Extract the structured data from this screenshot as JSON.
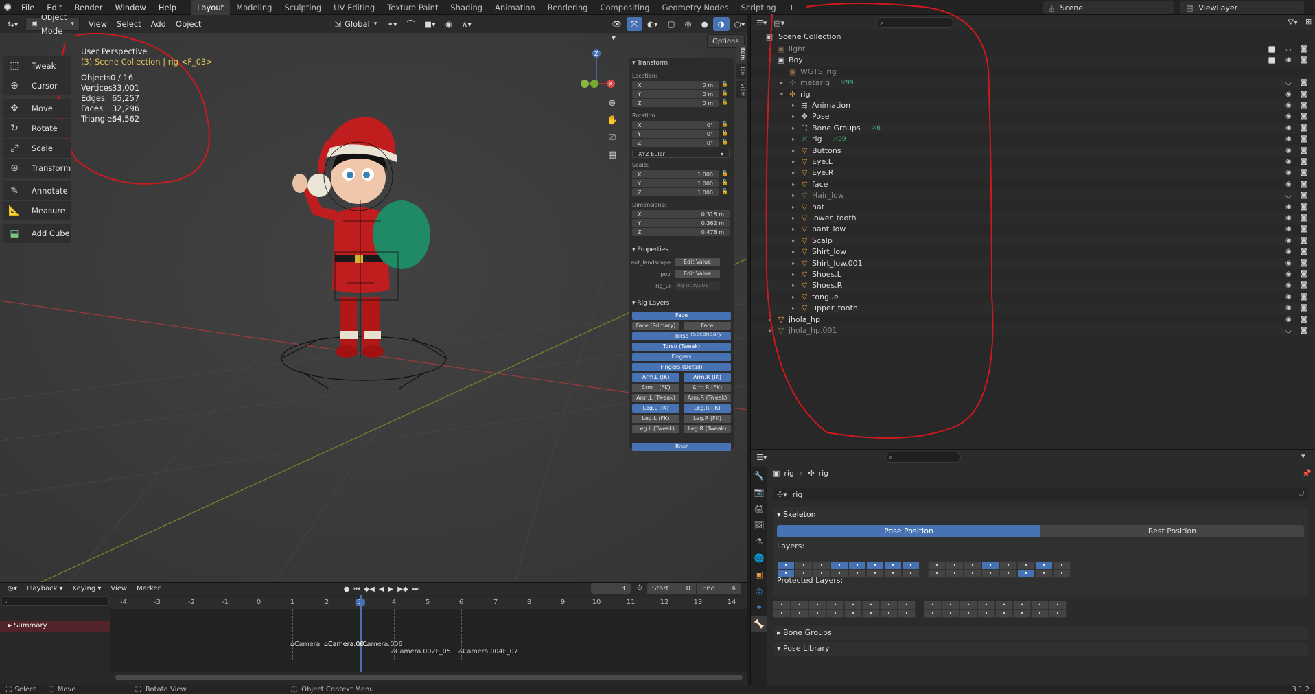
{
  "topbar": {
    "menus": [
      "File",
      "Edit",
      "Render",
      "Window",
      "Help"
    ],
    "workspaces": [
      "Layout",
      "Modeling",
      "Sculpting",
      "UV Editing",
      "Texture Paint",
      "Shading",
      "Animation",
      "Rendering",
      "Compositing",
      "Geometry Nodes",
      "Scripting"
    ],
    "active_workspace": "Layout",
    "scene": "Scene",
    "view_layer": "ViewLayer"
  },
  "viewport": {
    "mode": "Object Mode",
    "menus": [
      "View",
      "Select",
      "Add",
      "Object"
    ],
    "orientation": "Global",
    "options_label": "Options",
    "perspective": "User Perspective",
    "collection_info": "(3) Scene Collection | rig <F_03>",
    "stats": [
      {
        "label": "Objects",
        "value": "0 / 16"
      },
      {
        "label": "Vertices",
        "value": "33,001"
      },
      {
        "label": "Edges",
        "value": "65,257"
      },
      {
        "label": "Faces",
        "value": "32,296"
      },
      {
        "label": "Triangles",
        "value": "64,562"
      }
    ],
    "tools": [
      "Tweak",
      "Cursor",
      "Move",
      "Rotate",
      "Scale",
      "Transform",
      "Annotate",
      "Measure",
      "Add Cube"
    ],
    "side_tabs": [
      "Item",
      "Tool",
      "View"
    ]
  },
  "npanel": {
    "transform_title": "Transform",
    "location_label": "Location:",
    "location": {
      "x": "0 m",
      "y": "0 m",
      "z": "0 m"
    },
    "rotation_label": "Rotation:",
    "rotation": {
      "x": "0°",
      "y": "0°",
      "z": "0°"
    },
    "rotation_mode": "XYZ Euler",
    "scale_label": "Scale:",
    "scale": {
      "x": "1.000",
      "y": "1.000",
      "z": "1.000"
    },
    "dimensions_label": "Dimensions:",
    "dimensions": {
      "x": "0.318 m",
      "y": "0.362 m",
      "z": "0.478 m"
    },
    "properties_title": "Properties",
    "custom_props": [
      {
        "name": "ant_landscape",
        "value": "Edit Value"
      },
      {
        "name": "pov",
        "value": "Edit Value"
      },
      {
        "name": "rig_ui",
        "value": "rig_ui.py.001"
      }
    ],
    "rig_layers_title": "Rig Layers",
    "rig_layers": {
      "face": "Face",
      "face_primary": "Face (Primary)",
      "face_secondary": "Face (Secondary)",
      "torso": "Torso",
      "torso_tweak": "Torso (Tweak)",
      "fingers": "Fingers",
      "fingers_detail": "Fingers (Detail)",
      "arm_l_ik": "Arm.L (IK)",
      "arm_r_ik": "Arm.R (IK)",
      "arm_l_fk": "Arm.L (FK)",
      "arm_r_fk": "Arm.R (FK)",
      "arm_l_tweak": "Arm.L (Tweak)",
      "arm_r_tweak": "Arm.R (Tweak)",
      "leg_l_ik": "Leg.L (IK)",
      "leg_r_ik": "Leg.R (IK)",
      "leg_l_fk": "Leg.L (FK)",
      "leg_r_fk": "Leg.R (FK)",
      "leg_l_tweak": "Leg.L (Tweak)",
      "leg_r_tweak": "Leg.R (Tweak)",
      "root": "Root"
    }
  },
  "timeline": {
    "menus": [
      "Playback",
      "Keying",
      "View",
      "Marker"
    ],
    "current_frame": "3",
    "start_label": "Start",
    "start": "0",
    "end_label": "End",
    "end": "4",
    "ticks": [
      "-4",
      "-3",
      "-2",
      "-1",
      "0",
      "1",
      "2",
      "3",
      "4",
      "5",
      "6",
      "7",
      "8",
      "9",
      "10",
      "11",
      "12",
      "13",
      "14"
    ],
    "summary": "Summary",
    "markers": [
      "Camera",
      "Camera.001",
      "Camera.006",
      "Camera.002F_05",
      "Camera.004F_07"
    ]
  },
  "statusbar": {
    "select": "Select",
    "move": "Move",
    "rotate_view": "Rotate View",
    "context_menu": "Object Context Menu",
    "version": "3.1.2"
  },
  "outliner": {
    "root": "Scene Collection",
    "rows": [
      {
        "label": "light",
        "depth": 1,
        "icon": "collection",
        "dim": true,
        "check": true
      },
      {
        "label": "Boy",
        "depth": 1,
        "icon": "collection",
        "open": true,
        "check": true
      },
      {
        "label": "WGTS_rig",
        "depth": 2,
        "icon": "collection",
        "dim": true
      },
      {
        "label": "metarig",
        "depth": 2,
        "icon": "armature",
        "dim": true,
        "badge": "99"
      },
      {
        "label": "rig",
        "depth": 2,
        "icon": "armature",
        "open": true
      },
      {
        "label": "Animation",
        "depth": 3,
        "icon": "anim"
      },
      {
        "label": "Pose",
        "depth": 3,
        "icon": "pose"
      },
      {
        "label": "Bone Groups",
        "depth": 3,
        "icon": "group",
        "badge": "6"
      },
      {
        "label": "rig",
        "depth": 3,
        "icon": "bone",
        "badge": "99"
      },
      {
        "label": "Buttons",
        "depth": 3,
        "icon": "mesh"
      },
      {
        "label": "Eye.L",
        "depth": 3,
        "icon": "mesh"
      },
      {
        "label": "Eye.R",
        "depth": 3,
        "icon": "mesh"
      },
      {
        "label": "face",
        "depth": 3,
        "icon": "mesh"
      },
      {
        "label": "Hair_low",
        "depth": 3,
        "icon": "mesh",
        "dim": true
      },
      {
        "label": "hat",
        "depth": 3,
        "icon": "mesh"
      },
      {
        "label": "lower_tooth",
        "depth": 3,
        "icon": "mesh"
      },
      {
        "label": "pant_low",
        "depth": 3,
        "icon": "mesh"
      },
      {
        "label": "Scalp",
        "depth": 3,
        "icon": "mesh"
      },
      {
        "label": "Shirt_low",
        "depth": 3,
        "icon": "mesh"
      },
      {
        "label": "Shirt_low.001",
        "depth": 3,
        "icon": "mesh"
      },
      {
        "label": "Shoes.L",
        "depth": 3,
        "icon": "mesh"
      },
      {
        "label": "Shoes.R",
        "depth": 3,
        "icon": "mesh"
      },
      {
        "label": "tongue",
        "depth": 3,
        "icon": "mesh"
      },
      {
        "label": "upper_tooth",
        "depth": 3,
        "icon": "mesh"
      },
      {
        "label": "jhola_hp",
        "depth": 1,
        "icon": "mesh"
      },
      {
        "label": "jhola_hp.001",
        "depth": 1,
        "icon": "mesh",
        "dim": true
      }
    ]
  },
  "properties": {
    "breadcrumb": [
      "rig",
      "rig"
    ],
    "data_name": "rig",
    "skeleton_title": "Skeleton",
    "pose_position": "Pose Position",
    "rest_position": "Rest Position",
    "layers_label": "Layers:",
    "protected_layers_label": "Protected Layers:",
    "bone_groups": "Bone Groups",
    "pose_library": "Pose Library"
  },
  "colors": {
    "accent_blue": "#4772b3",
    "annotation_red": "#d0191c",
    "stats_yellow": "#e2c65a",
    "playhead": "#4772b3"
  }
}
